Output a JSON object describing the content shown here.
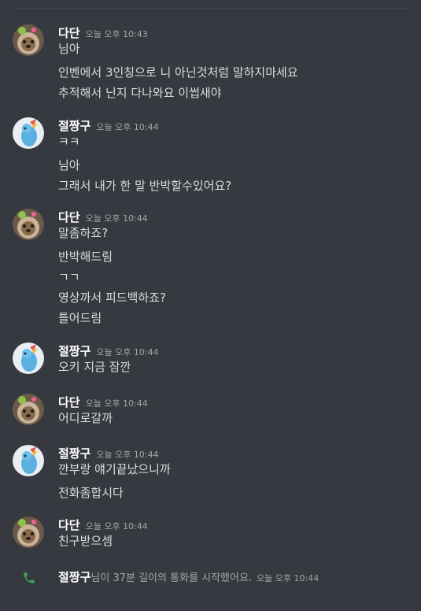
{
  "messages": [
    {
      "author": "다단",
      "avatar": "dog-avatar",
      "time": "오늘 오후 10:43",
      "lines": [
        "님아",
        "인벤에서 3인칭으로 니 아닌것처럼 말하지마세요",
        "추적해서 닌지 다나와요 이썹새야"
      ]
    },
    {
      "author": "절짱구",
      "avatar": "plush-avatar",
      "time": "오늘 오후 10:44",
      "lines": [
        "ㅋㅋ",
        "님아",
        "그래서 내가 한 말 반박할수있어요?"
      ]
    },
    {
      "author": "다단",
      "avatar": "dog-avatar",
      "time": "오늘 오후 10:44",
      "lines": [
        "말좀하죠?",
        "반박해드림",
        "ㄱㄱ",
        "영상까서 피드백하죠?",
        "틀어드림"
      ]
    },
    {
      "author": "절짱구",
      "avatar": "plush-avatar",
      "time": "오늘 오후 10:44",
      "lines": [
        "오키 지금 잠깐"
      ]
    },
    {
      "author": "다단",
      "avatar": "dog-avatar",
      "time": "오늘 오후 10:44",
      "lines": [
        "어디로갈까"
      ]
    },
    {
      "author": "절짱구",
      "avatar": "plush-avatar",
      "time": "오늘 오후 10:44",
      "lines": [
        "깐부랑 얘기끝났으니까",
        "전화좀합시다"
      ]
    },
    {
      "author": "다단",
      "avatar": "dog-avatar",
      "time": "오늘 오후 10:44",
      "lines": [
        "친구받으셈"
      ]
    }
  ],
  "call": {
    "icon": "phone-icon",
    "user": "절짱구",
    "text": "님이 37분 길이의 통화를 시작했어요.",
    "time": "오늘 오후 10:44"
  },
  "colors": {
    "background": "#36393f",
    "username": "#ffffff",
    "message": "#dcddde",
    "timestamp": "#a3a6aa",
    "call_icon": "#3ba55c"
  }
}
